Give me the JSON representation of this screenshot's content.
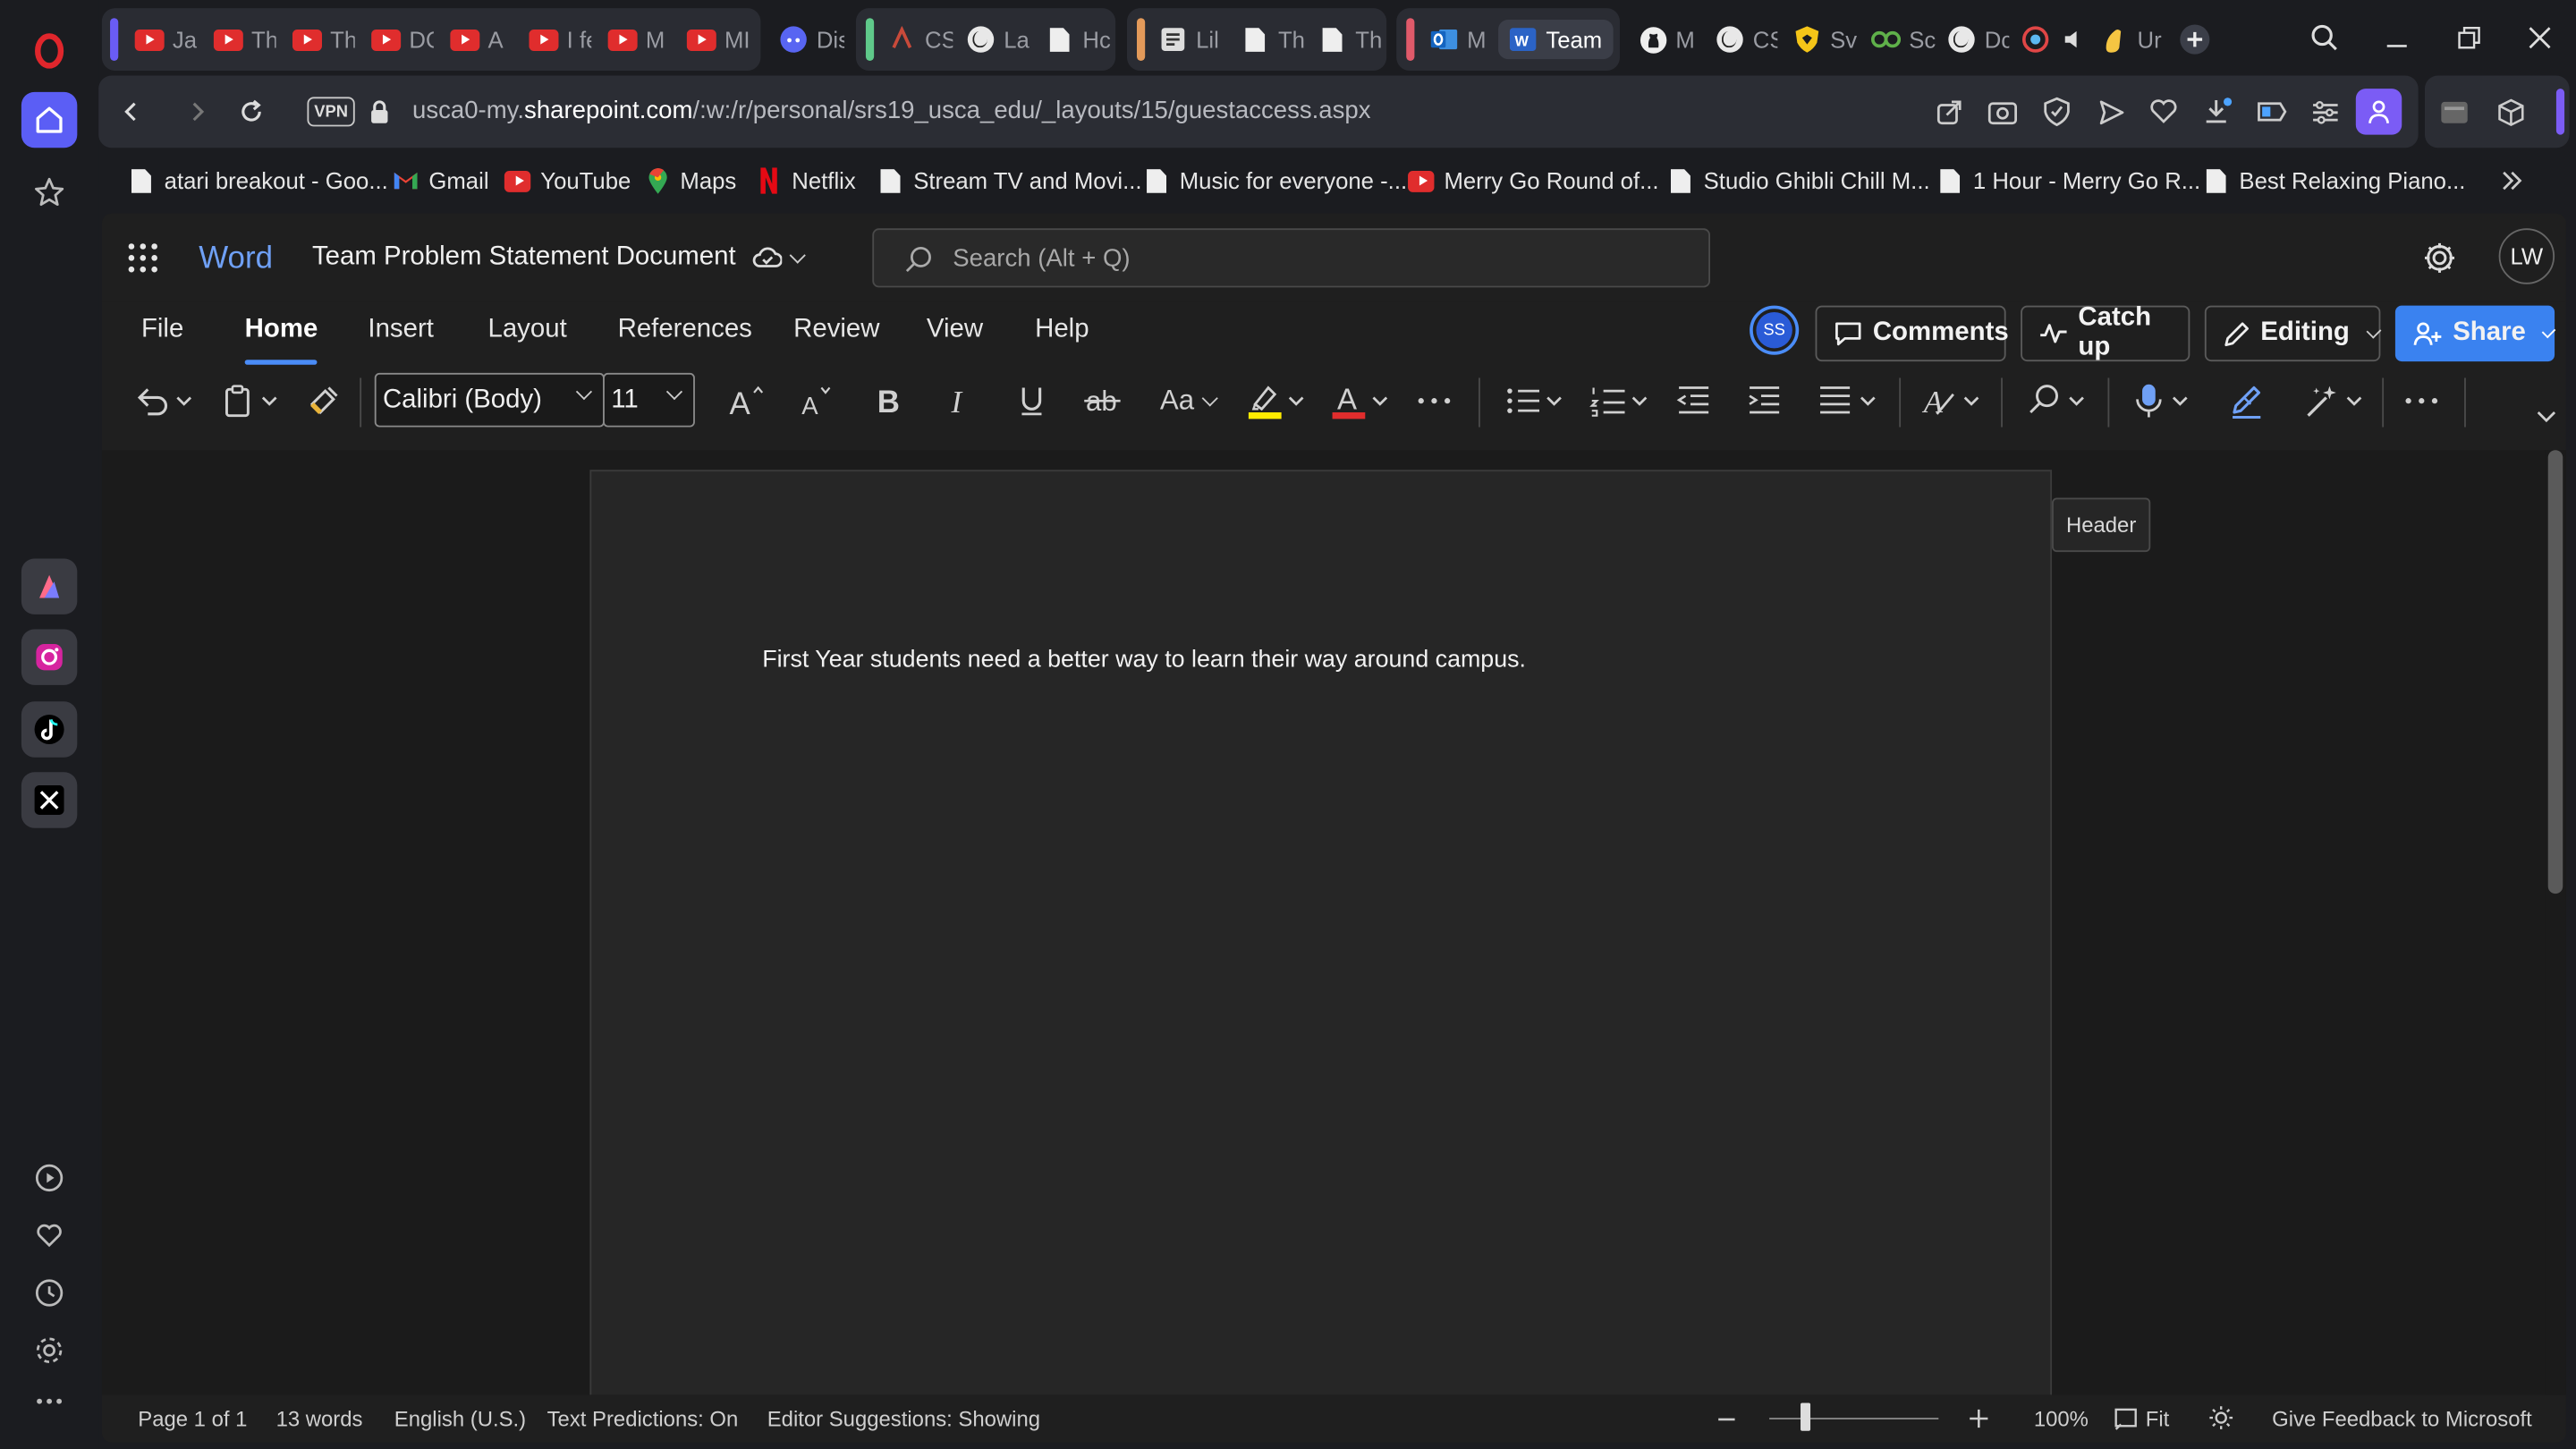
{
  "browser": {
    "tabs": [
      {
        "label": "Ja",
        "icon": "youtube-icon"
      },
      {
        "label": "Th",
        "icon": "youtube-icon"
      },
      {
        "label": "Th",
        "icon": "youtube-icon"
      },
      {
        "label": "DC",
        "icon": "youtube-icon"
      },
      {
        "label": "A",
        "icon": "youtube-icon"
      },
      {
        "label": "I fe",
        "icon": "youtube-icon"
      },
      {
        "label": "M",
        "icon": "youtube-icon"
      },
      {
        "label": "MI",
        "icon": "youtube-icon"
      },
      {
        "label": "Dis",
        "icon": "discord-icon"
      },
      {
        "label": "CS",
        "icon": "site-icon"
      },
      {
        "label": "La",
        "icon": "globe-icon"
      },
      {
        "label": "Hc",
        "icon": "document-icon"
      },
      {
        "label": "Lil",
        "icon": "site-icon"
      },
      {
        "label": "Th",
        "icon": "document-icon"
      },
      {
        "label": "Th",
        "icon": "document-icon"
      },
      {
        "label": "M",
        "icon": "outlook-icon"
      },
      {
        "label": "Team",
        "icon": "word-icon",
        "active": true
      },
      {
        "label": "M",
        "icon": "github-icon"
      },
      {
        "label": "CS",
        "icon": "globe-icon"
      },
      {
        "label": "Sv",
        "icon": "shield-icon"
      },
      {
        "label": "Sc",
        "icon": "site-icon"
      },
      {
        "label": "Dc",
        "icon": "globe-icon"
      },
      {
        "label": "Ur",
        "icon": "music-icon"
      }
    ],
    "address": {
      "vpn_label": "VPN",
      "url_prefix": "usca0-my.",
      "url_domain": "sharepoint.com",
      "url_path": "/:w:/r/personal/srs19_usca_edu/_layouts/15/guestaccess.aspx"
    },
    "bookmarks": [
      {
        "label": "atari breakout - Goo...",
        "icon": "document-icon"
      },
      {
        "label": "Gmail",
        "icon": "gmail-icon"
      },
      {
        "label": "YouTube",
        "icon": "youtube-icon"
      },
      {
        "label": "Maps",
        "icon": "maps-icon"
      },
      {
        "label": "Netflix",
        "icon": "netflix-icon"
      },
      {
        "label": "Stream TV and Movi...",
        "icon": "document-icon"
      },
      {
        "label": "Music for everyone -...",
        "icon": "document-icon"
      },
      {
        "label": "Merry Go Round of...",
        "icon": "youtube-icon"
      },
      {
        "label": "Studio Ghibli Chill M...",
        "icon": "document-icon"
      },
      {
        "label": "1 Hour - Merry Go R...",
        "icon": "document-icon"
      },
      {
        "label": "Best Relaxing Piano...",
        "icon": "document-icon"
      }
    ]
  },
  "word": {
    "app_name": "Word",
    "doc_title": "Team Problem Statement Document",
    "search_placeholder": "Search (Alt + Q)",
    "user_initials": "LW",
    "collaborator_initials": "SS",
    "menu": [
      "File",
      "Home",
      "Insert",
      "Layout",
      "References",
      "Review",
      "View",
      "Help"
    ],
    "active_menu": "Home",
    "buttons": {
      "comments": "Comments",
      "catch_up": "Catch up",
      "editing": "Editing",
      "share": "Share"
    },
    "font_name": "Calibri (Body)",
    "font_size": "11",
    "change_case_label": "Aa",
    "header_tooltip": "Header",
    "body_text": "First Year students need a better way to learn their way around campus.",
    "status": {
      "page": "Page 1 of 1",
      "words": "13 words",
      "language": "English (U.S.)",
      "predictions": "Text Predictions: On",
      "suggestions": "Editor Suggestions: Showing",
      "zoom": "100%",
      "fit": "Fit",
      "feedback": "Give Feedback to Microsoft"
    }
  },
  "colors": {
    "accent": "#4a8cf7",
    "opera_red": "#e0262c",
    "share_button": "#3a82f0",
    "highlight_yellow": "#ffeb00",
    "font_red": "#e12d2d"
  }
}
